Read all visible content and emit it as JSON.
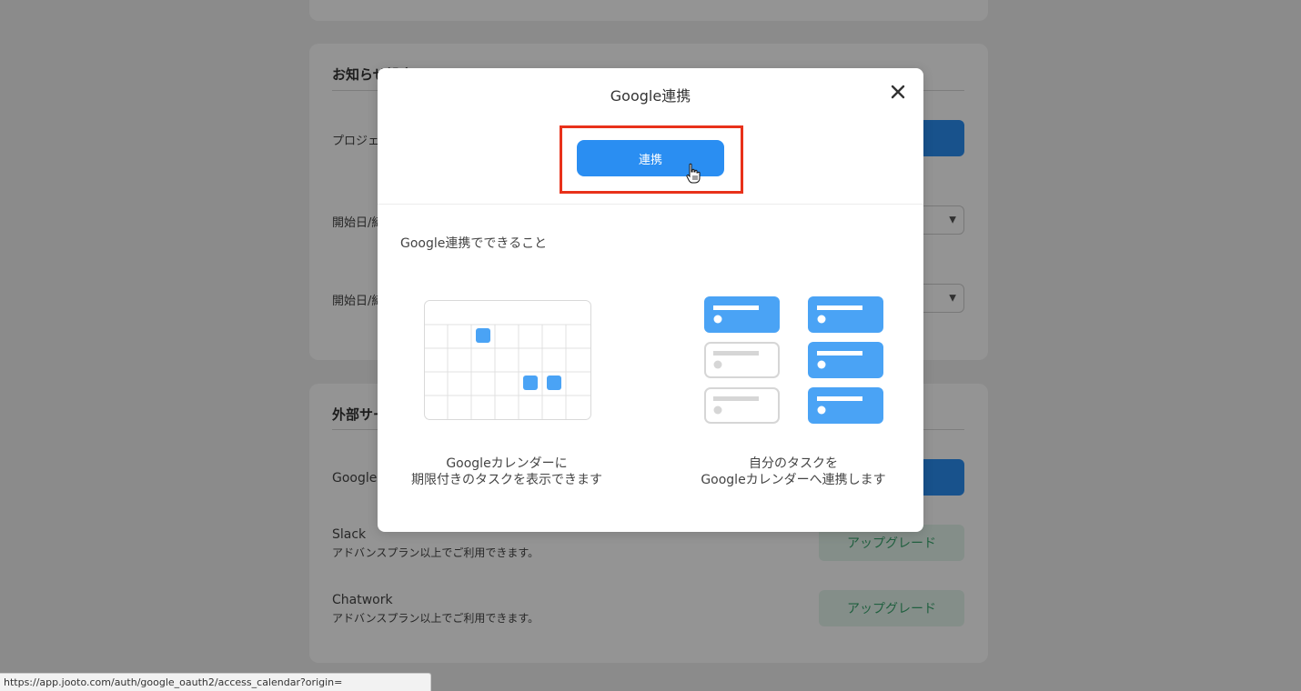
{
  "background": {
    "notify_section": {
      "title": "お知らせ設定",
      "rows": [
        {
          "label": "プロジェクト"
        },
        {
          "label": "開始日/締"
        },
        {
          "label": "開始日/締"
        }
      ]
    },
    "external_section": {
      "title": "外部サービス",
      "google_label": "Google",
      "services": [
        {
          "name": "Slack",
          "note": "アドバンスプラン以上でご利用できます。",
          "button": "アップグレード"
        },
        {
          "name": "Chatwork",
          "note": "アドバンスプラン以上でご利用できます。",
          "button": "アップグレード"
        }
      ]
    }
  },
  "modal": {
    "title": "Google連携",
    "link_button": "連携",
    "features_heading": "Google連携でできること",
    "feature_left_caption_1": "Googleカレンダーに",
    "feature_left_caption_2": "期限付きのタスクを表示できます",
    "feature_right_caption_1": "自分のタスクを",
    "feature_right_caption_2": "Googleカレンダーへ連携します"
  },
  "status_bar": {
    "url": "https://app.jooto.com/auth/google_oauth2/access_calendar?origin="
  },
  "colors": {
    "accent": "#2a8ef2",
    "highlight": "#e8311a",
    "upgrade_text": "#3aa56e"
  }
}
